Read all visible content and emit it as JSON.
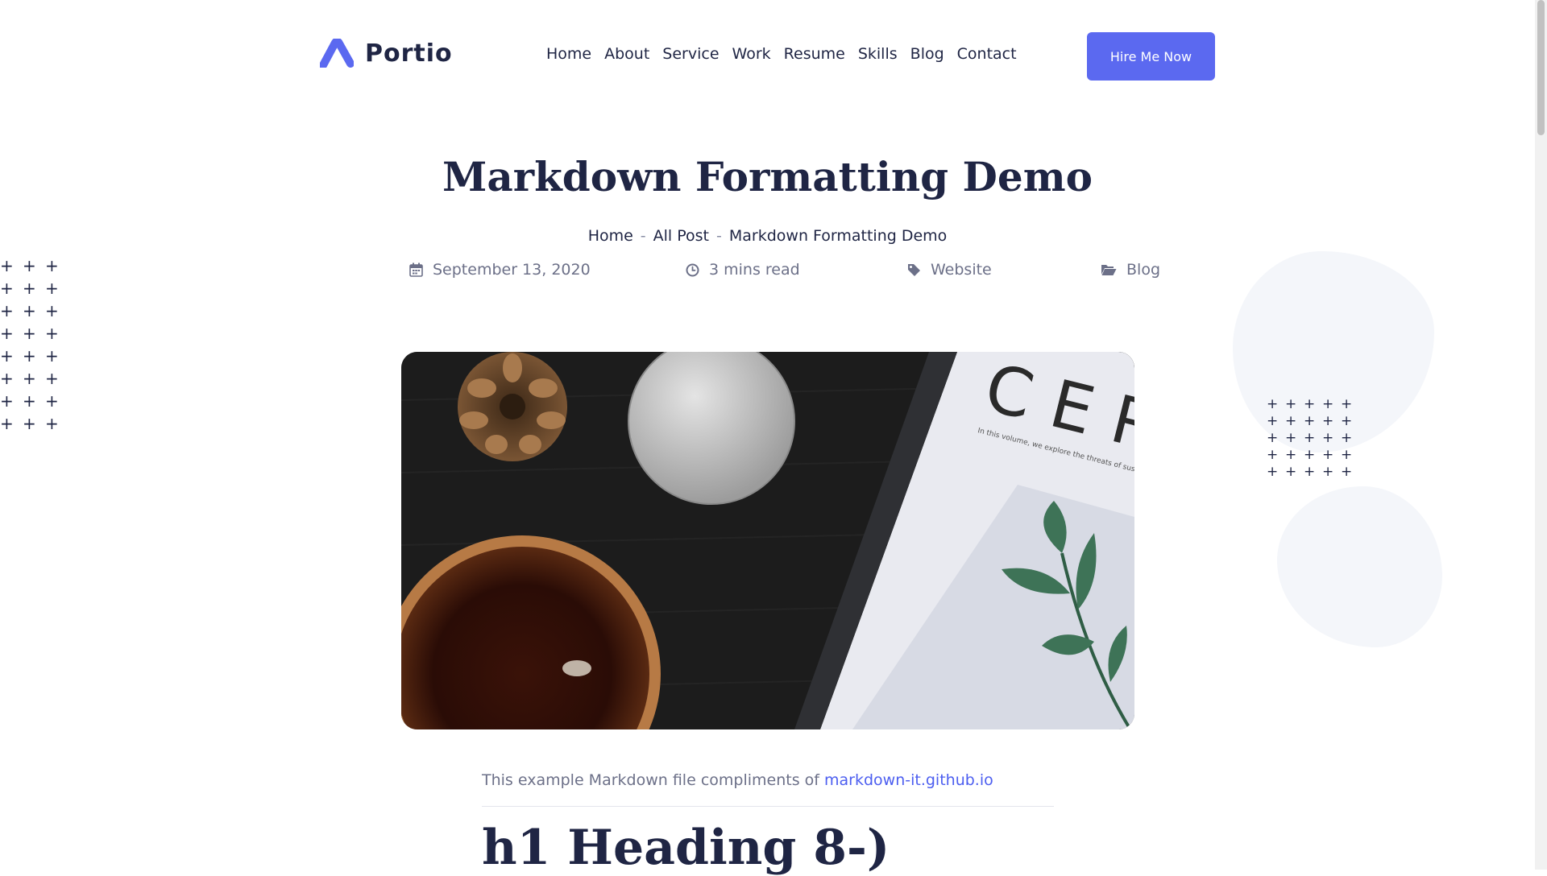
{
  "header": {
    "logo_text": "Portio",
    "nav": [
      "Home",
      "About",
      "Service",
      "Work",
      "Resume",
      "Skills",
      "Blog",
      "Contact"
    ],
    "cta_label": "Hire Me Now"
  },
  "page": {
    "title": "Markdown Formatting Demo",
    "breadcrumb": [
      "Home",
      "All Post",
      "Markdown Formatting Demo"
    ],
    "breadcrumb_separator": "-",
    "meta": {
      "date": "September 13, 2020",
      "read_time": "3 mins read",
      "tag": "Website",
      "category": "Blog"
    }
  },
  "article": {
    "intro_text": "This example Markdown file compliments of",
    "intro_link": "markdown-it.github.io",
    "heading": "h1 Heading 8-)"
  },
  "hero_image": {
    "magazine_text": "C E R",
    "magazine_caption": "In this volume, we explore the threats of sustainability"
  },
  "colors": {
    "accent": "#5b69f0",
    "text_dark": "#1f2544",
    "text_muted": "#6c7088",
    "link": "#4c5ef0",
    "blob": "#f4f6fa"
  },
  "icons": [
    "logo-mark-icon",
    "calendar-icon",
    "clock-icon",
    "tag-icon",
    "folder-icon"
  ]
}
